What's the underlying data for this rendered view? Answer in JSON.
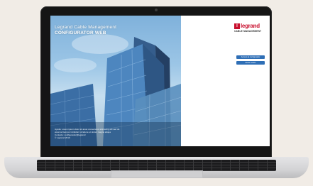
{
  "hero": {
    "title": "Legrand Cable Management",
    "subtitle": "CONFIGURATOR WEB",
    "footer_line1": "Ayuda: Lorem ipsum dolor sit amet consectetur adipiscing elit sed do",
    "footer_line2": "eiusmod tempor incididunt ut labore et dolore magna aliqua",
    "footer_line3": "Contacto: configurador@legrand",
    "footer_line4": "© Legrand 2019"
  },
  "brand": {
    "mark": "l",
    "name": "legrand",
    "tagline": "CABLE MANAGEMENT",
    "color": "#c8102e"
  },
  "actions": {
    "primary": "Acceso al configurador",
    "secondary": "Iniciar sesión",
    "button_color": "#2f6fb6"
  }
}
